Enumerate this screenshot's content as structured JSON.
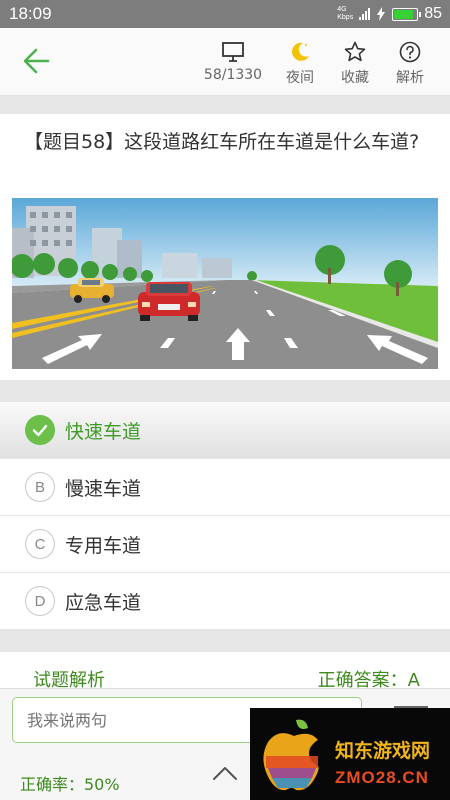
{
  "status_bar": {
    "time": "18:09",
    "network": "4G",
    "speed": "Kbps",
    "battery": "85",
    "battery_level": 0.85
  },
  "toolbar": {
    "progress": "58/1330",
    "night_label": "夜间",
    "favorite_label": "收藏",
    "explain_label": "解析"
  },
  "question": {
    "text": "【题目58】这段道路红车所在车道是什么车道?"
  },
  "options": [
    {
      "letter": "A",
      "text": "快速车道",
      "selected": true
    },
    {
      "letter": "B",
      "text": "慢速车道",
      "selected": false
    },
    {
      "letter": "C",
      "text": "专用车道",
      "selected": false
    },
    {
      "letter": "D",
      "text": "应急车道",
      "selected": false
    }
  ],
  "analysis": {
    "title": "试题解析",
    "answer": "正确答案：A"
  },
  "comment": {
    "placeholder": "我来说两句"
  },
  "stats": {
    "accuracy": "正确率：50%"
  },
  "watermark": {
    "line1": "知东游戏网",
    "line2": "ZMO28.CN"
  },
  "colors": {
    "accent": "#3f8a1f",
    "check": "#6cc04a",
    "statusbar": "#7d7d7d"
  }
}
